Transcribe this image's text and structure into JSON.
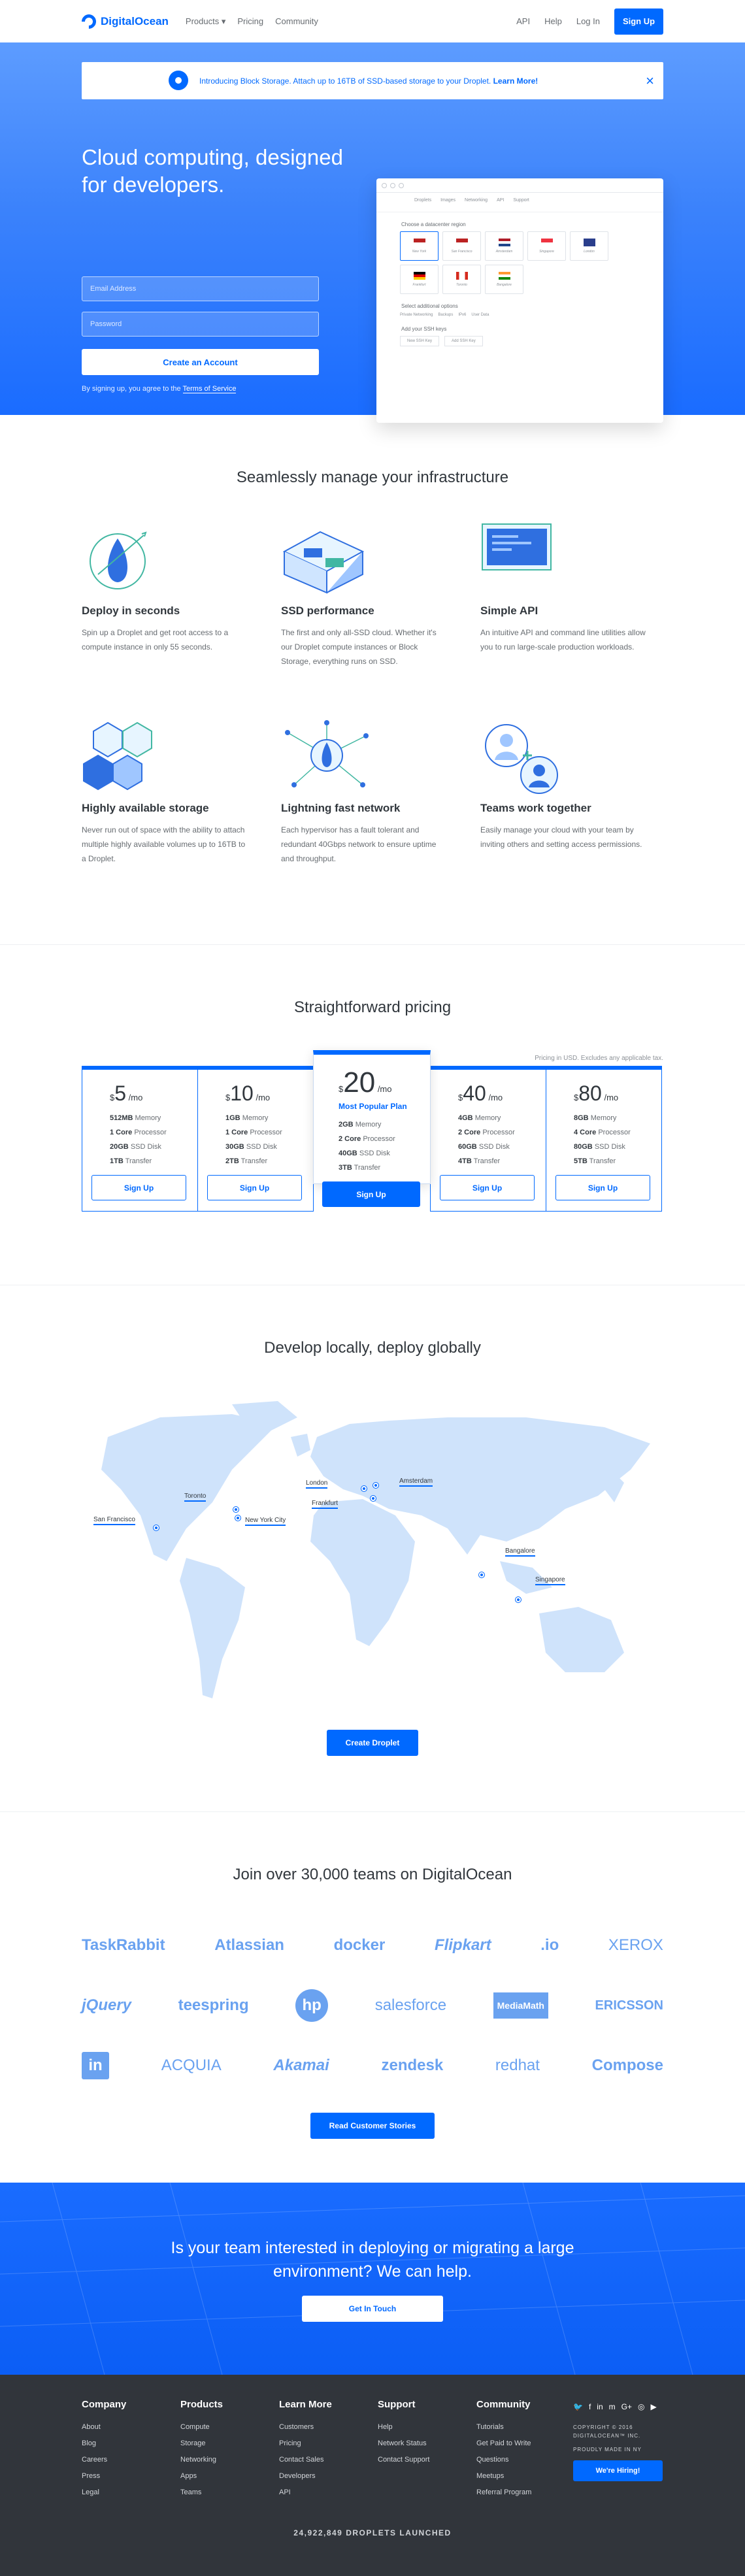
{
  "header": {
    "brand": "DigitalOcean",
    "nav": [
      "Products",
      "Pricing",
      "Community"
    ],
    "right_links": [
      "API",
      "Help",
      "Log In"
    ],
    "signup": "Sign Up"
  },
  "announcement": {
    "text": "Introducing Block Storage. Attach up to 16TB of SSD-based storage to your Droplet.",
    "link": "Learn More!"
  },
  "hero": {
    "title": "Cloud computing, designed for developers.",
    "email_placeholder": "Email Address",
    "password_placeholder": "Password",
    "create_account": "Create an Account",
    "agree_text": "By signing up, you agree to the",
    "terms_link": "Terms of Service",
    "mock": {
      "tabs": [
        "Droplets",
        "Images",
        "Networking",
        "API",
        "Support"
      ],
      "region_label": "Choose a datacenter region",
      "regions": [
        "New York",
        "San Francisco",
        "Amsterdam",
        "Singapore",
        "London",
        "Frankfurt",
        "Toronto",
        "Bangalore"
      ],
      "options_label": "Select additional options",
      "options": [
        "Private Networking",
        "Backups",
        "IPv6",
        "User Data"
      ],
      "ssh_label": "Add your SSH keys",
      "ssh_buttons": [
        "New SSH Key",
        "Add SSH Key"
      ]
    }
  },
  "features": {
    "title": "Seamlessly manage your infrastructure",
    "items": [
      {
        "title": "Deploy in seconds",
        "text": "Spin up a Droplet and get root access to a compute instance in only 55 seconds."
      },
      {
        "title": "SSD performance",
        "text": "The first and only all-SSD cloud. Whether it's our Droplet compute instances or Block Storage, everything runs on SSD."
      },
      {
        "title": "Simple API",
        "text": "An intuitive API and command line utilities allow you to run large-scale production workloads."
      },
      {
        "title": "Highly available storage",
        "text": "Never run out of space with the ability to attach multiple highly available volumes up to 16TB to a Droplet."
      },
      {
        "title": "Lightning fast network",
        "text": "Each hypervisor has a fault tolerant and redundant 40Gbps network to ensure uptime and throughput."
      },
      {
        "title": "Teams work together",
        "text": "Easily manage your cloud with your team by inviting others and setting access permissions."
      }
    ]
  },
  "pricing": {
    "title": "Straightforward pricing",
    "note": "Pricing in USD. Excludes any applicable tax.",
    "popular_label": "Most Popular Plan",
    "button": "Sign Up",
    "plans": [
      {
        "price": "5",
        "unit": "/mo",
        "memory": "512MB",
        "cpu": "1 Core",
        "disk": "20GB",
        "transfer": "1TB"
      },
      {
        "price": "10",
        "unit": "/mo",
        "memory": "1GB",
        "cpu": "1 Core",
        "disk": "30GB",
        "transfer": "2TB"
      },
      {
        "price": "20",
        "unit": "/mo",
        "memory": "2GB",
        "cpu": "2 Core",
        "disk": "40GB",
        "transfer": "3TB"
      },
      {
        "price": "40",
        "unit": "/mo",
        "memory": "4GB",
        "cpu": "2 Core",
        "disk": "60GB",
        "transfer": "4TB"
      },
      {
        "price": "80",
        "unit": "/mo",
        "memory": "8GB",
        "cpu": "4 Core",
        "disk": "80GB",
        "transfer": "5TB"
      }
    ],
    "labels": {
      "memory": "Memory",
      "cpu": "Processor",
      "disk": "SSD Disk",
      "transfer": "Transfer"
    }
  },
  "map": {
    "title": "Develop locally, deploy globally",
    "cities": [
      "San Francisco",
      "Toronto",
      "New York City",
      "London",
      "Frankfurt",
      "Amsterdam",
      "Bangalore",
      "Singapore"
    ],
    "button": "Create Droplet"
  },
  "customers": {
    "title": "Join over 30,000 teams on DigitalOcean",
    "logos": [
      [
        "TaskRabbit",
        "Atlassian",
        "docker",
        "Flipkart",
        ".io",
        "XEROX"
      ],
      [
        "jQuery",
        "teespring",
        "hp",
        "salesforce",
        "MediaMath",
        "ERICSSON"
      ],
      [
        "in",
        "ACQUIA",
        "Akamai",
        "zendesk",
        "redhat",
        "Compose"
      ]
    ],
    "button": "Read Customer Stories"
  },
  "cta": {
    "title": "Is your team interested in deploying or migrating a large environment? We can help.",
    "button": "Get In Touch"
  },
  "footer": {
    "columns": [
      {
        "title": "Company",
        "links": [
          "About",
          "Blog",
          "Careers",
          "Press",
          "Legal"
        ]
      },
      {
        "title": "Products",
        "links": [
          "Compute",
          "Storage",
          "Networking",
          "Apps",
          "Teams"
        ]
      },
      {
        "title": "Learn More",
        "links": [
          "Customers",
          "Pricing",
          "Contact Sales",
          "Developers",
          "API"
        ]
      },
      {
        "title": "Support",
        "links": [
          "Help",
          "Network Status",
          "Contact Support"
        ]
      },
      {
        "title": "Community",
        "links": [
          "Tutorials",
          "Get Paid to Write",
          "Questions",
          "Meetups",
          "Referral Program"
        ]
      }
    ],
    "copyright": "COPYRIGHT © 2016 DIGITALOCEAN™ INC.",
    "made": "PROUDLY MADE IN NY",
    "hiring": "We're Hiring!",
    "droplets": "24,922,849 DROPLETS LAUNCHED"
  }
}
